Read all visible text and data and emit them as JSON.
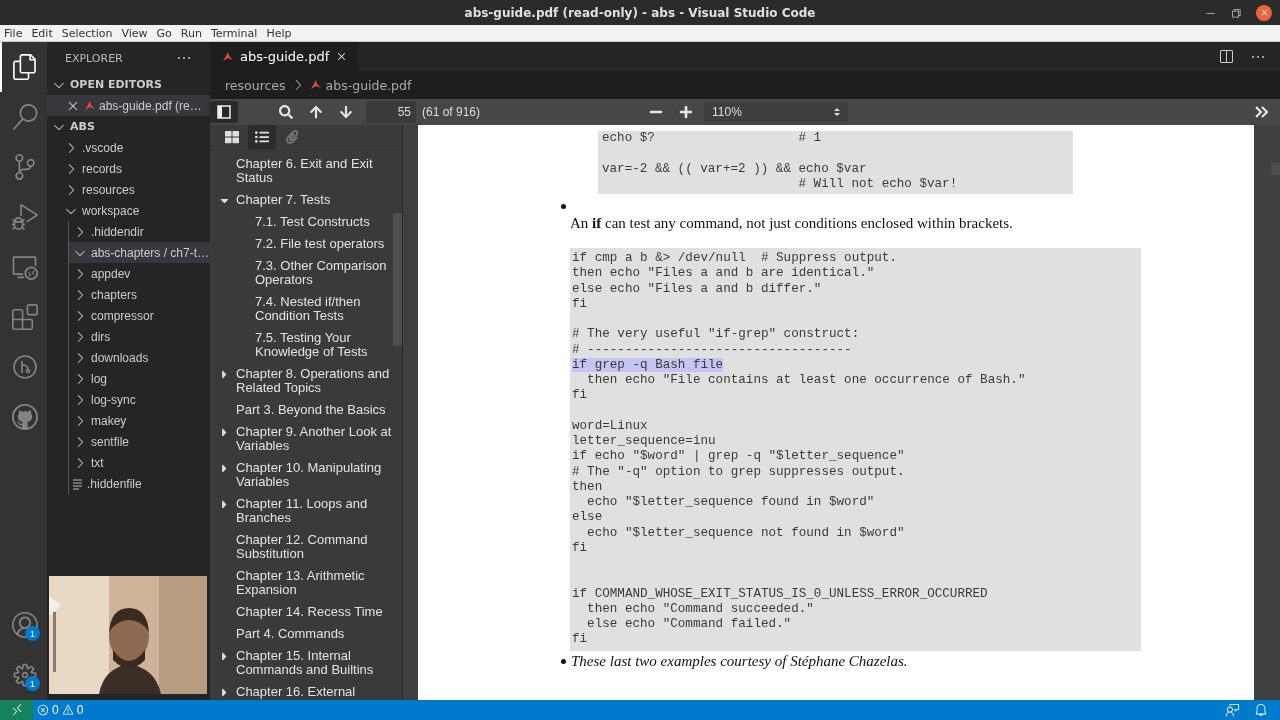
{
  "window": {
    "title": "abs-guide.pdf (read-only) - abs - Visual Studio Code"
  },
  "menu": [
    "File",
    "Edit",
    "Selection",
    "View",
    "Go",
    "Run",
    "Terminal",
    "Help"
  ],
  "activity_bar": {
    "top": [
      {
        "kind": "explorer",
        "selected": true
      },
      {
        "kind": "search",
        "selected": false
      },
      {
        "kind": "source_control",
        "selected": false
      },
      {
        "kind": "run",
        "selected": false
      },
      {
        "kind": "remote",
        "selected": false
      },
      {
        "kind": "extensions",
        "selected": false
      },
      {
        "kind": "history",
        "selected": false
      },
      {
        "kind": "github",
        "selected": false
      }
    ],
    "bottom": [
      {
        "kind": "accounts",
        "badge": "1"
      },
      {
        "kind": "settings",
        "badge": "1"
      }
    ]
  },
  "sidebar": {
    "title": "EXPLORER",
    "open_editors": {
      "title": "OPEN EDITORS",
      "expanded": true,
      "items": [
        {
          "label": "abs-guide.pdf (re…",
          "selected": true
        }
      ]
    },
    "folder": {
      "title": "ABS",
      "expanded": true,
      "tree": [
        {
          "label": ".vscode",
          "kind": "folder",
          "expanded": false,
          "selected": false
        },
        {
          "label": "records",
          "kind": "folder",
          "expanded": false,
          "selected": false
        },
        {
          "label": "resources",
          "kind": "folder",
          "expanded": false,
          "selected": false
        },
        {
          "label": "workspace",
          "kind": "folder",
          "expanded": true,
          "selected": false,
          "children": [
            {
              "label": ".hiddendir",
              "kind": "folder",
              "expanded": false,
              "selected": false
            },
            {
              "label": "abs-chapters / ch7-t…",
              "kind": "folder",
              "expanded": true,
              "selected": true
            },
            {
              "label": "appdev",
              "kind": "folder",
              "expanded": false,
              "selected": false
            },
            {
              "label": "chapters",
              "kind": "folder",
              "expanded": false,
              "selected": false
            },
            {
              "label": "compressor",
              "kind": "folder",
              "expanded": false,
              "selected": false
            },
            {
              "label": "dirs",
              "kind": "folder",
              "expanded": false,
              "selected": false
            },
            {
              "label": "downloads",
              "kind": "folder",
              "expanded": false,
              "selected": false
            },
            {
              "label": "log",
              "kind": "folder",
              "expanded": false,
              "selected": false
            },
            {
              "label": "log-sync",
              "kind": "folder",
              "expanded": false,
              "selected": false
            },
            {
              "label": "makey",
              "kind": "folder",
              "expanded": false,
              "selected": false
            },
            {
              "label": "sentfile",
              "kind": "folder",
              "expanded": false,
              "selected": false
            },
            {
              "label": "txt",
              "kind": "folder",
              "expanded": false,
              "selected": false
            },
            {
              "label": ".hiddenfile",
              "kind": "file",
              "selected": false
            }
          ]
        }
      ]
    }
  },
  "webcam": {
    "kind": "picture"
  },
  "tabs": [
    {
      "label": "abs-guide.pdf",
      "selected": true
    }
  ],
  "breadcrumbs": [
    "resources",
    "abs-guide.pdf"
  ],
  "pdf_toolbar": {
    "sidebar_open": true,
    "page": "55",
    "page_count": "(61 of 916)",
    "zoom": "110%"
  },
  "toc": {
    "views": [
      {
        "kind": "thumbnails",
        "selected": false,
        "disabled": false
      },
      {
        "kind": "outline",
        "selected": true,
        "disabled": false
      },
      {
        "kind": "attachments",
        "selected": false,
        "disabled": true
      }
    ],
    "items": [
      {
        "label": "Chapter 6. Exit and Exit Status",
        "kind": "leaf"
      },
      {
        "label": "Chapter 7. Tests",
        "kind": "branch",
        "expanded": true,
        "children": [
          {
            "label": "7.1. Test Constructs",
            "kind": "leaf"
          },
          {
            "label": "7.2. File test operators",
            "kind": "leaf"
          },
          {
            "label": "7.3. Other Comparison Operators",
            "kind": "leaf"
          },
          {
            "label": "7.4. Nested if/then Condition Tests",
            "kind": "leaf"
          },
          {
            "label": "7.5. Testing Your Knowledge of Tests",
            "kind": "leaf"
          }
        ]
      },
      {
        "label": "Chapter 8. Operations and Related Topics",
        "kind": "branch",
        "expanded": false
      },
      {
        "label": "Part 3. Beyond the Basics",
        "kind": "leaf"
      },
      {
        "label": "Chapter 9. Another Look at Variables",
        "kind": "branch",
        "expanded": false
      },
      {
        "label": "Chapter 10. Manipulating Variables",
        "kind": "branch",
        "expanded": false
      },
      {
        "label": "Chapter 11. Loops and Branches",
        "kind": "branch",
        "expanded": false
      },
      {
        "label": "Chapter 12. Command Substitution",
        "kind": "leaf"
      },
      {
        "label": "Chapter 13. Arithmetic Expansion",
        "kind": "leaf"
      },
      {
        "label": "Chapter 14. Recess Time",
        "kind": "leaf"
      },
      {
        "label": "Part 4. Commands",
        "kind": "leaf"
      },
      {
        "label": "Chapter 15. Internal Commands and Builtins",
        "kind": "branch",
        "expanded": false
      },
      {
        "label": "Chapter 16. External",
        "kind": "branch",
        "expanded": false
      }
    ]
  },
  "page": {
    "blocks": [
      {
        "kind": "code",
        "nested": true,
        "segments": [
          {
            "text": "echo $?                   # 1\n\nvar=-2 && (( var+=2 )) && echo $var\n                          # Will not echo $var!",
            "highlighted": false
          }
        ]
      },
      {
        "kind": "bullet_paragraph",
        "text": "An **if** can test any command, not just conditions enclosed within brackets.",
        "italic": false
      },
      {
        "kind": "code",
        "nested": false,
        "segments": [
          {
            "text": "if cmp a b &> /dev/null  # Suppress output.\nthen echo \"Files a and b are identical.\"\nelse echo \"Files a and b differ.\"\nfi\n\n# The very useful \"if-grep\" construct:\n# -----------------------------------\n",
            "highlighted": false
          },
          {
            "text": "if grep -q Bash file",
            "highlighted": true
          },
          {
            "text": "\n  then echo \"File contains at least one occurrence of Bash.\"\nfi\n\nword=Linux\nletter_sequence=inu\nif echo \"$word\" | grep -q \"$letter_sequence\"\n# The \"-q\" option to grep suppresses output.\nthen\n  echo \"$letter_sequence found in $word\"\nelse\n  echo \"$letter_sequence not found in $word\"\nfi\n\n\nif COMMAND_WHOSE_EXIT_STATUS_IS_0_UNLESS_ERROR_OCCURRED\n  then echo \"Command succeeded.\"\n  else echo \"Command failed.\"\nfi",
            "highlighted": false
          }
        ]
      },
      {
        "kind": "bullet_inline",
        "text": "These last two examples courtesy of Stéphane Chazelas.",
        "italic": true
      }
    ]
  },
  "status_bar": {
    "errors": "0",
    "warnings": "0"
  }
}
